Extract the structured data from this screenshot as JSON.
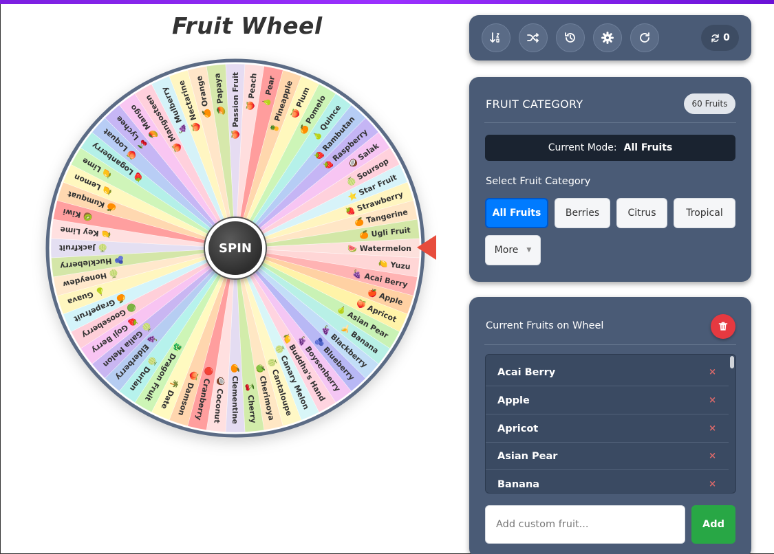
{
  "title": "Fruit Wheel",
  "wheel": {
    "spin_label": "SPIN",
    "segments": [
      {
        "label": "Watermelon",
        "emoji": "🍉",
        "color": "#fde0dc"
      },
      {
        "label": "Yuzu",
        "emoji": "🍋",
        "color": "#ffd6d6"
      },
      {
        "label": "Acai Berry",
        "emoji": "🍇",
        "color": "#ffb3b3"
      },
      {
        "label": "Apple",
        "emoji": "🍎",
        "color": "#ffd1a3"
      },
      {
        "label": "Apricot",
        "emoji": "🍑",
        "color": "#fff3a8"
      },
      {
        "label": "Asian Pear",
        "emoji": "🍐",
        "color": "#c9f2b5"
      },
      {
        "label": "Banana",
        "emoji": "🍌",
        "color": "#b8f0e6"
      },
      {
        "label": "Blackberry",
        "emoji": "🍇",
        "color": "#c2def7"
      },
      {
        "label": "Blueberry",
        "emoji": "🫐",
        "color": "#b8b8f5"
      },
      {
        "label": "Boysenberry",
        "emoji": "🍇",
        "color": "#f4c6f4"
      },
      {
        "label": "Buddha's Hand",
        "emoji": "🍋",
        "color": "#ffd4e0"
      },
      {
        "label": "Canary Melon",
        "emoji": "🍈",
        "color": "#d8f6f8"
      },
      {
        "label": "Cantaloupe",
        "emoji": "🍈",
        "color": "#fff8c6"
      },
      {
        "label": "Cherimoya",
        "emoji": "🍏",
        "color": "#ffe7c4"
      },
      {
        "label": "Cherry",
        "emoji": "🍒",
        "color": "#d2ecaa"
      },
      {
        "label": "Clementine",
        "emoji": "🍊",
        "color": "#e4dcf2"
      },
      {
        "label": "Coconut",
        "emoji": "🥥",
        "color": "#ffe0e0"
      },
      {
        "label": "Cranberry",
        "emoji": "🔴",
        "color": "#ff9e9e"
      },
      {
        "label": "Damson",
        "emoji": "🍑",
        "color": "#ffd6ae"
      },
      {
        "label": "Date",
        "emoji": "🌴",
        "color": "#fffac0"
      },
      {
        "label": "Dragon Fruit",
        "emoji": "🐉",
        "color": "#cdf5b6"
      },
      {
        "label": "Durian",
        "emoji": "🍈",
        "color": "#b6f2ec"
      },
      {
        "label": "Elderberry",
        "emoji": "🍇",
        "color": "#b6cdf2"
      },
      {
        "label": "Galia Melon",
        "emoji": "🍈",
        "color": "#c9b6f2"
      },
      {
        "label": "Goji Berry",
        "emoji": "🍓",
        "color": "#f8c4f2"
      },
      {
        "label": "Gooseberry",
        "emoji": "🟢",
        "color": "#ffcfd9"
      },
      {
        "label": "Grapefruit",
        "emoji": "🍊",
        "color": "#d4f4fa"
      },
      {
        "label": "Guava",
        "emoji": "🍐",
        "color": "#fff6bf"
      },
      {
        "label": "Honeydew",
        "emoji": "🍈",
        "color": "#ffe8cc"
      },
      {
        "label": "Huckleberry",
        "emoji": "🫐",
        "color": "#d4e6a8"
      },
      {
        "label": "Jackfruit",
        "emoji": "🍈",
        "color": "#e4dff2"
      },
      {
        "label": "Key Lime",
        "emoji": "🍋",
        "color": "#ffe0e0"
      },
      {
        "label": "Kiwi",
        "emoji": "🥝",
        "color": "#ff9f9f"
      },
      {
        "label": "Kumquat",
        "emoji": "🍊",
        "color": "#ffd8b0"
      },
      {
        "label": "Lemon",
        "emoji": "🍋",
        "color": "#fff8bf"
      },
      {
        "label": "Lime",
        "emoji": "🍋",
        "color": "#cff5b9"
      },
      {
        "label": "Loganberry",
        "emoji": "🍓",
        "color": "#b4f0e8"
      },
      {
        "label": "Loquat",
        "emoji": "🍑",
        "color": "#b8cdf5"
      },
      {
        "label": "Lychee",
        "emoji": "🍒",
        "color": "#c6b6f5"
      },
      {
        "label": "Mango",
        "emoji": "🥭",
        "color": "#f9c6f2"
      },
      {
        "label": "Mangosteen",
        "emoji": "🍑",
        "color": "#ffd0dc"
      },
      {
        "label": "Mulberry",
        "emoji": "🍇",
        "color": "#d5f2f8"
      },
      {
        "label": "Nectarine",
        "emoji": "🍑",
        "color": "#fff6c2"
      },
      {
        "label": "Orange",
        "emoji": "🍊",
        "color": "#ffe6c9"
      },
      {
        "label": "Papaya",
        "emoji": "🥭",
        "color": "#d6e8ab"
      },
      {
        "label": "Passion Fruit",
        "emoji": "🍑",
        "color": "#e6dcf2"
      },
      {
        "label": "Peach",
        "emoji": "🍑",
        "color": "#ffdede"
      },
      {
        "label": "Pear",
        "emoji": "🍐",
        "color": "#ff9d9d"
      },
      {
        "label": "Pineapple",
        "emoji": "🍍",
        "color": "#ffd7ad"
      },
      {
        "label": "Plum",
        "emoji": "🍑",
        "color": "#fff8bd"
      },
      {
        "label": "Pomelo",
        "emoji": "🍊",
        "color": "#cdf5b7"
      },
      {
        "label": "Quince",
        "emoji": "🍐",
        "color": "#b5f1e9"
      },
      {
        "label": "Rambutan",
        "emoji": "🍓",
        "color": "#b6cdf5"
      },
      {
        "label": "Raspberry",
        "emoji": "🍓",
        "color": "#c5b5f5"
      },
      {
        "label": "Salak",
        "emoji": "🥥",
        "color": "#f7c5f3"
      },
      {
        "label": "Soursop",
        "emoji": "🍈",
        "color": "#ffd1dc"
      },
      {
        "label": "Star Fruit",
        "emoji": "⭐",
        "color": "#d7f3f9"
      },
      {
        "label": "Strawberry",
        "emoji": "🍓",
        "color": "#fff5c0"
      },
      {
        "label": "Tangerine",
        "emoji": "🍊",
        "color": "#ffe6c6"
      },
      {
        "label": "Ugli Fruit",
        "emoji": "🍊",
        "color": "#d3e7a7"
      }
    ]
  },
  "toolbar": {
    "buttons": [
      {
        "name": "sort-icon"
      },
      {
        "name": "shuffle-icon"
      },
      {
        "name": "history-icon"
      },
      {
        "name": "gear-icon"
      },
      {
        "name": "refresh-icon"
      }
    ],
    "spin_count": "0"
  },
  "category": {
    "title": "FRUIT CATEGORY",
    "count_badge": "60 Fruits",
    "mode_label": "Current Mode:",
    "mode_value": "All Fruits",
    "select_label": "Select Fruit Category",
    "buttons": [
      "All Fruits",
      "Berries",
      "Citrus",
      "Tropical"
    ],
    "more_label": "More",
    "active": "All Fruits"
  },
  "fruits": {
    "title": "Current Fruits on Wheel",
    "items": [
      "Acai Berry",
      "Apple",
      "Apricot",
      "Asian Pear",
      "Banana"
    ],
    "remove_glyph": "×",
    "add_placeholder": "Add custom fruit...",
    "add_label": "Add"
  },
  "colors": {
    "panel": "#4a5b76",
    "accent": "#007bff",
    "danger": "#e53940",
    "success": "#28a745",
    "pointer": "#e74c3c",
    "wheel_rim": "#5b6b85"
  }
}
